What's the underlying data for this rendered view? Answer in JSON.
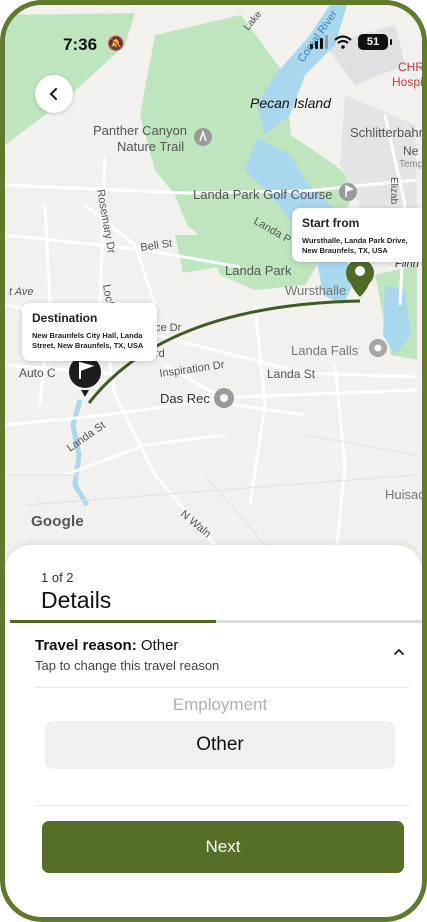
{
  "status_bar": {
    "time": "7:36",
    "battery": "51"
  },
  "map": {
    "labels": {
      "pecan_island": "Pecan Island",
      "panther_canyon": "Panther Canyon",
      "nature_trail": "Nature Trail",
      "schlitterbahn": "Schlitterbahn",
      "schlitter_ne": "Ne",
      "schlitter_temp": "Temp",
      "chr": "CHR",
      "hospital": "Hospit",
      "golf_course": "Landa Park Golf Course",
      "landa_park": "Landa Park",
      "landa_park_diag": "Landa P",
      "wursthalle": "Wursthalle",
      "landa_falls": "Landa Falls",
      "landa_st": "Landa St",
      "landa_st_lower": "Landa St",
      "bell_st": "Bell St",
      "rosemary_dr": "Rosemary Dr",
      "inspiration_dr": "Inspiration Dr",
      "das_rec": "Das Rec",
      "auto_c": "Auto C",
      "ave": "t Ave",
      "ce_dr": "ce Dr",
      "lock": "Lock",
      "rd": "rd",
      "huisach": "Huisach",
      "n_wal": "N Waln",
      "comal_river": "Comal River",
      "lake": "Lake",
      "elizab": "Elizab",
      "flinn": "Flinn"
    },
    "start_callout": {
      "title": "Start from",
      "address": "Wursthalle, Landa Park Drive, New Braunfels, TX, USA"
    },
    "destination_callout": {
      "title": "Destination",
      "address": "New Braunfels City Hall, Landa Street, New Braunfels, TX, USA"
    },
    "attribution": "Google"
  },
  "sheet": {
    "step": "1 of 2",
    "title": "Details",
    "progress": 0.5,
    "reason_label": "Travel reason:",
    "reason_value": " Other",
    "reason_hint": "Tap to change this travel reason",
    "picker_options": [
      "Employment",
      "Other"
    ],
    "next_label": "Next"
  },
  "colors": {
    "accent": "#556f27",
    "frame": "#5f7a2e",
    "route": "#3f5a22",
    "park": "#bfe5bf",
    "water": "#a9d7ee"
  }
}
